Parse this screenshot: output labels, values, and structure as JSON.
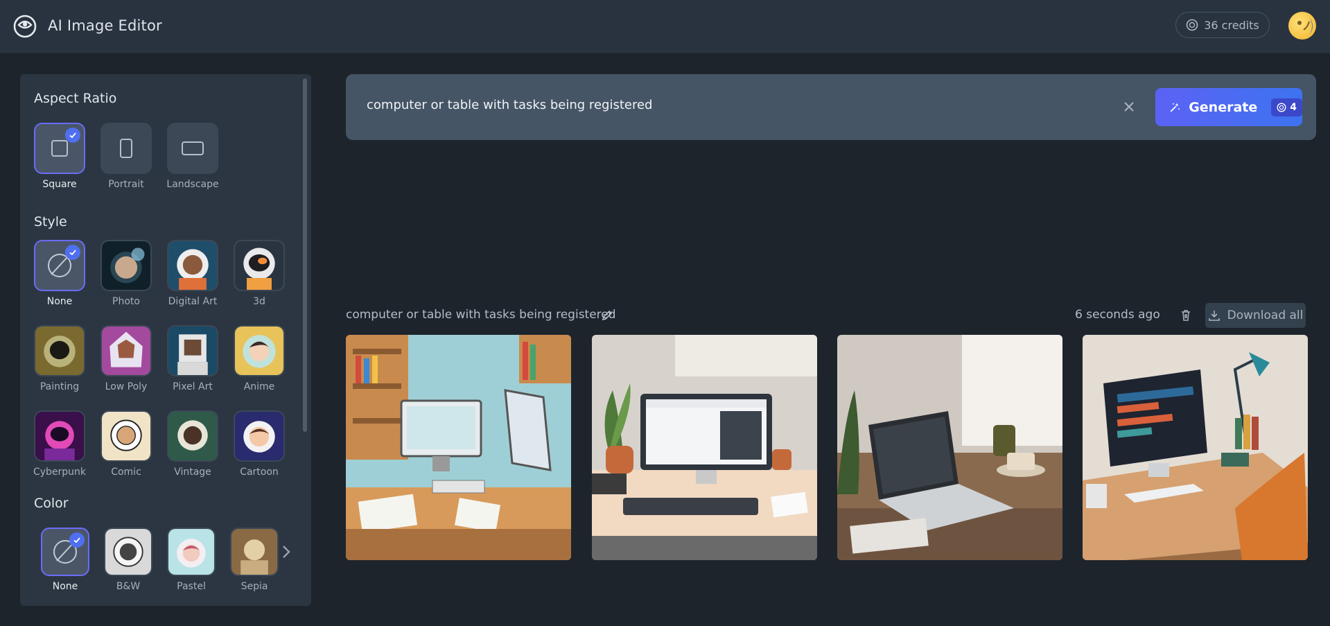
{
  "header": {
    "title": "AI Image Editor",
    "credits": "36 credits"
  },
  "sidebar": {
    "aspect_title": "Aspect Ratio",
    "aspect": [
      {
        "label": "Square",
        "selected": true
      },
      {
        "label": "Portrait",
        "selected": false
      },
      {
        "label": "Landscape",
        "selected": false
      }
    ],
    "style_title": "Style",
    "styles": [
      {
        "label": "None",
        "selected": true
      },
      {
        "label": "Photo"
      },
      {
        "label": "Digital Art"
      },
      {
        "label": "3d"
      },
      {
        "label": "Painting"
      },
      {
        "label": "Low Poly"
      },
      {
        "label": "Pixel Art"
      },
      {
        "label": "Anime"
      },
      {
        "label": "Cyberpunk"
      },
      {
        "label": "Comic"
      },
      {
        "label": "Vintage"
      },
      {
        "label": "Cartoon"
      }
    ],
    "color_title": "Color",
    "colors": [
      {
        "label": "None",
        "selected": true
      },
      {
        "label": "B&W"
      },
      {
        "label": "Pastel"
      },
      {
        "label": "Sepia"
      }
    ]
  },
  "prompt": {
    "value": "computer or table with tasks being registered",
    "generate_label": "Generate",
    "generate_cost": "4"
  },
  "results": {
    "title": "computer or table with tasks being registered",
    "time": "6 seconds ago",
    "download_label": "Download all"
  },
  "colors": {
    "accent": "#5b62f4",
    "selected_border": "#6b6cf7",
    "check": "#4f6ff0"
  }
}
